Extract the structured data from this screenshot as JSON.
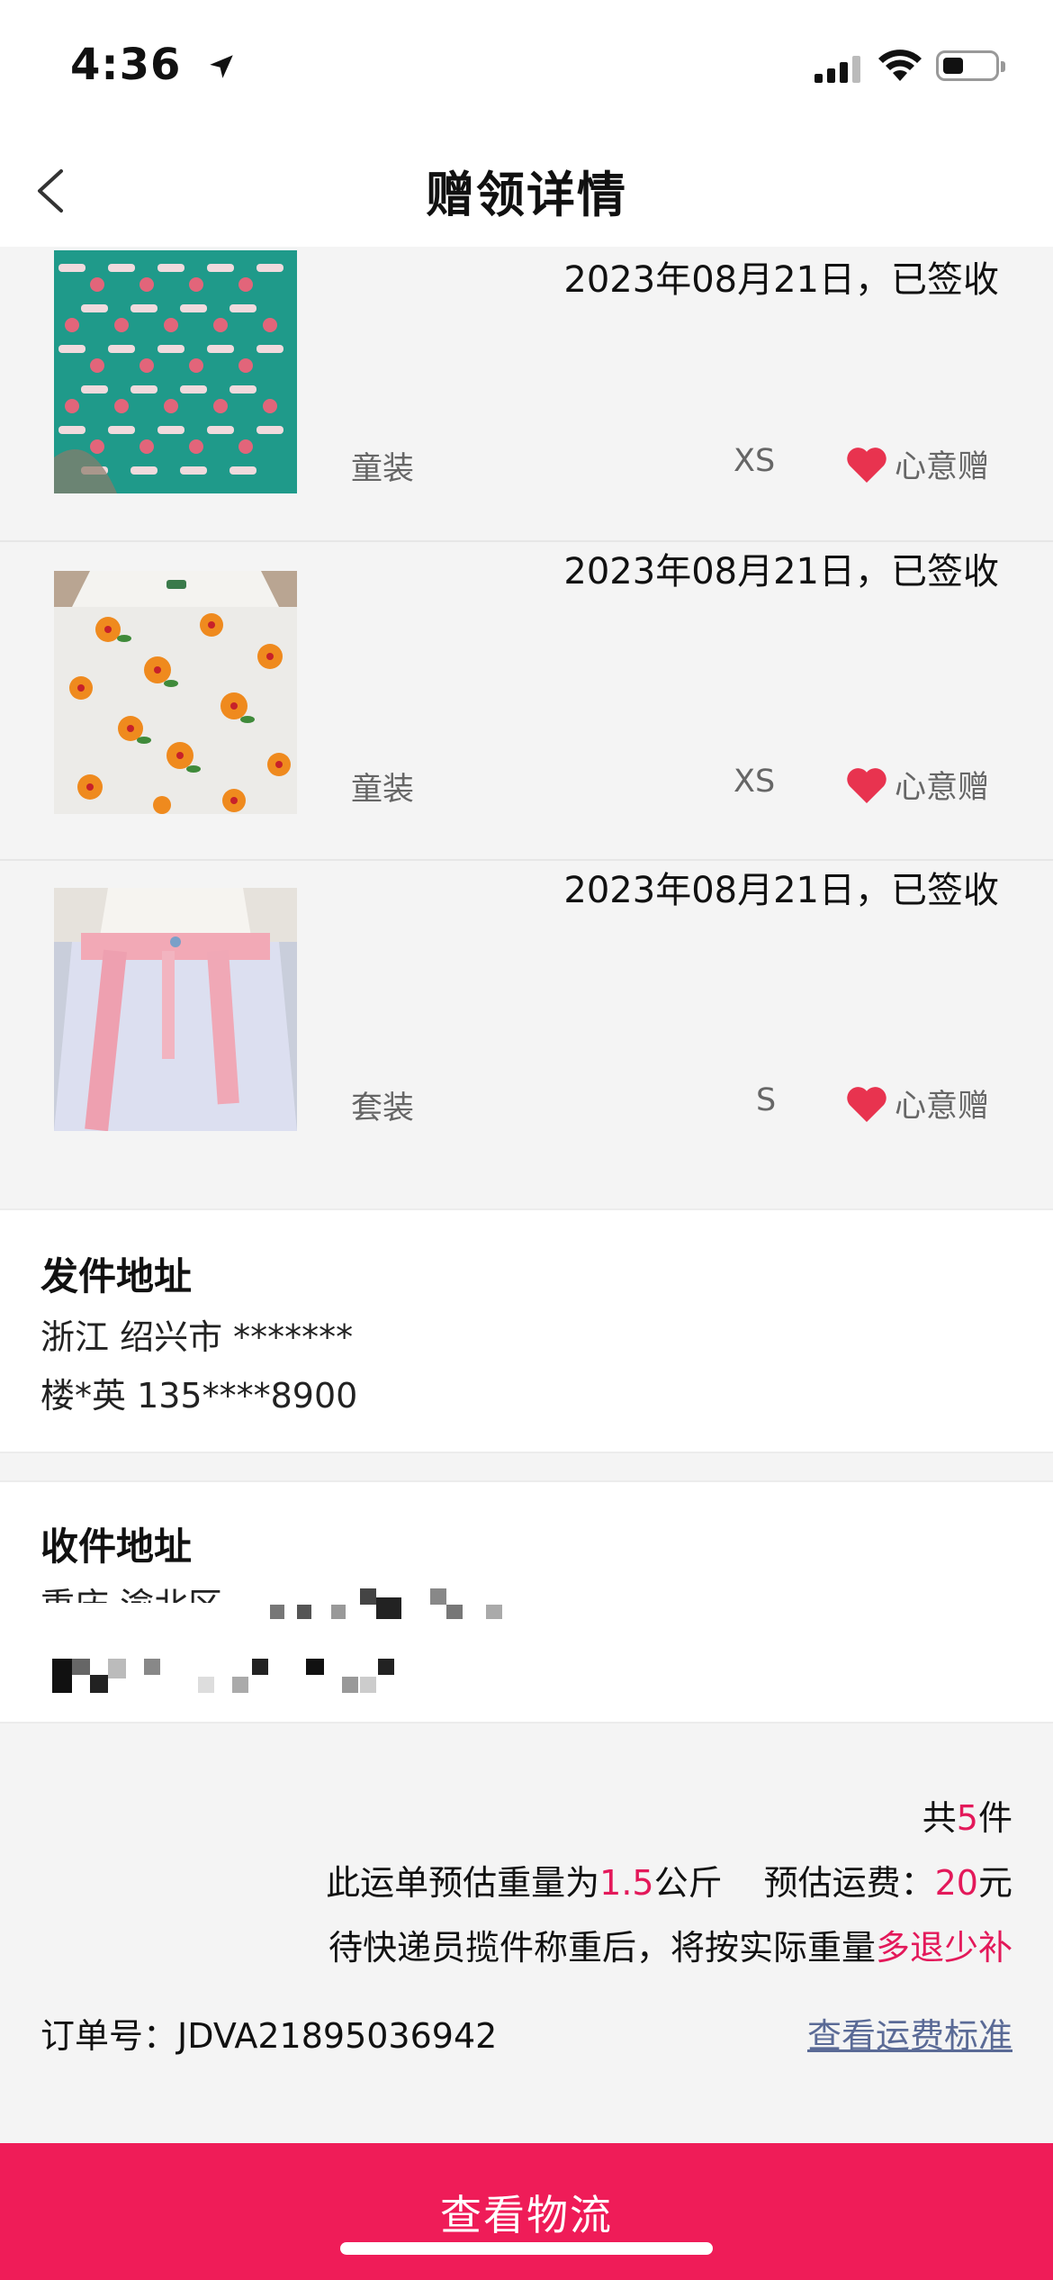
{
  "status": {
    "time": "4:36"
  },
  "nav": {
    "title": "赠领详情"
  },
  "items": [
    {
      "date": "2023年08月21日，已签收",
      "category": "童装",
      "size": "XS",
      "tag": "心意赠"
    },
    {
      "date": "2023年08月21日，已签收",
      "category": "童装",
      "size": "XS",
      "tag": "心意赠"
    },
    {
      "date": "2023年08月21日，已签收",
      "category": "套装",
      "size": "S",
      "tag": "心意赠"
    }
  ],
  "sender": {
    "title": "发件地址",
    "region": "浙江 绍兴市 *******",
    "contact": "楼*英 135****8900"
  },
  "receiver": {
    "title": "收件地址",
    "region_partial": "重庆 渝北区"
  },
  "summary": {
    "count_prefix": "共",
    "count": "5",
    "count_suffix": "件",
    "weight_prefix": "此运单预估重量为",
    "weight": "1.5",
    "weight_unit": "公斤",
    "fee_label": "预估运费：",
    "fee": "20",
    "fee_unit": "元",
    "note_prefix": "待快递员揽件称重后，将按实际重量",
    "note_highlight": "多退少补",
    "order_label": "订单号：",
    "order_no": "JDVA21895036942",
    "fee_standard_link": "查看运费标准"
  },
  "bottom_button": {
    "label": "查看物流"
  },
  "colors": {
    "accent": "#ef1c58",
    "highlight": "#e3195a",
    "link": "#5a6a96"
  }
}
